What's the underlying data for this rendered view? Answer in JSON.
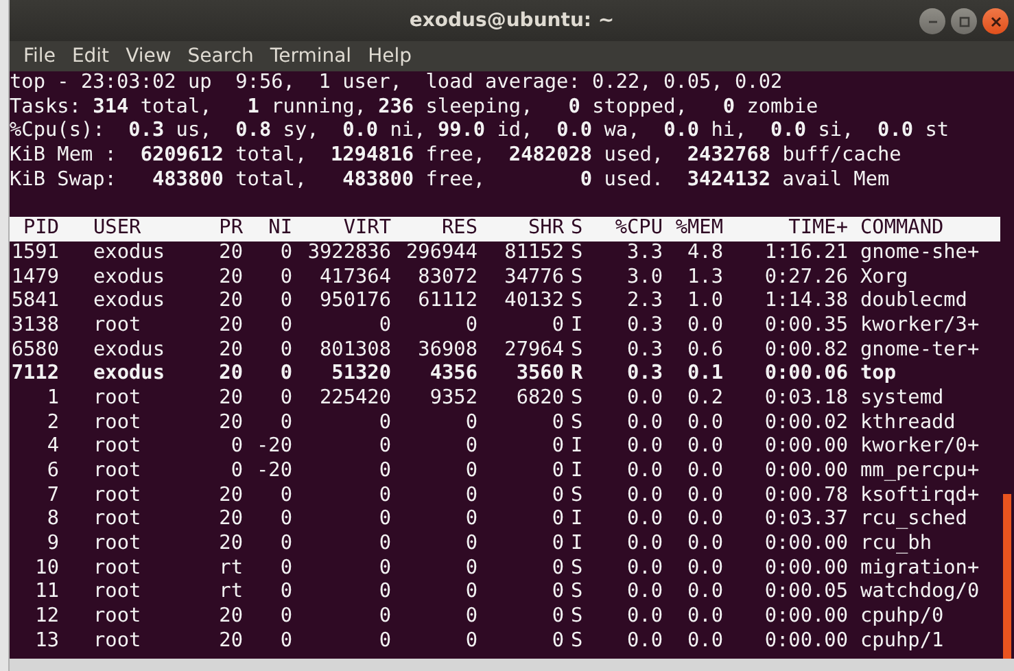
{
  "window": {
    "title": "exodus@ubuntu: ~"
  },
  "menu": [
    "File",
    "Edit",
    "View",
    "Search",
    "Terminal",
    "Help"
  ],
  "summary": [
    "top - 23:03:02 up  9:56,  1 user,  load average: 0.22, 0.05, 0.02",
    "Tasks: **314** total,   **1** running, **236** sleeping,   **0** stopped,   **0** zombie",
    "%Cpu(s):  **0.3** us,  **0.8** sy,  **0.0** ni, **99.0** id,  **0.0** wa,  **0.0** hi,  **0.0** si,  **0.0** st",
    "KiB Mem :  **6209612** total,  **1294816** free,  **2482028** used,  **2432768** buff/cache",
    "KiB Swap:   **483800** total,   **483800** free,        **0** used.  **3424132** avail Mem"
  ],
  "table": {
    "columns": [
      "PID",
      "USER",
      "PR",
      "NI",
      "VIRT",
      "RES",
      "SHR",
      "S",
      "%CPU",
      "%MEM",
      "TIME+",
      "COMMAND"
    ],
    "rows": [
      {
        "bold": false,
        "cells": [
          "1591",
          "exodus",
          "20",
          "0",
          "3922836",
          "296944",
          "81152",
          "S",
          "3.3",
          "4.8",
          "1:16.21",
          "gnome-she+"
        ]
      },
      {
        "bold": false,
        "cells": [
          "1479",
          "exodus",
          "20",
          "0",
          "417364",
          "83072",
          "34776",
          "S",
          "3.0",
          "1.3",
          "0:27.26",
          "Xorg"
        ]
      },
      {
        "bold": false,
        "cells": [
          "5841",
          "exodus",
          "20",
          "0",
          "950176",
          "61112",
          "40132",
          "S",
          "2.3",
          "1.0",
          "1:14.38",
          "doublecmd"
        ]
      },
      {
        "bold": false,
        "cells": [
          "3138",
          "root",
          "20",
          "0",
          "0",
          "0",
          "0",
          "I",
          "0.3",
          "0.0",
          "0:00.35",
          "kworker/3+"
        ]
      },
      {
        "bold": false,
        "cells": [
          "6580",
          "exodus",
          "20",
          "0",
          "801308",
          "36908",
          "27964",
          "S",
          "0.3",
          "0.6",
          "0:00.82",
          "gnome-ter+"
        ]
      },
      {
        "bold": true,
        "cells": [
          "7112",
          "exodus",
          "20",
          "0",
          "51320",
          "4356",
          "3560",
          "R",
          "0.3",
          "0.1",
          "0:00.06",
          "top"
        ]
      },
      {
        "bold": false,
        "cells": [
          "1",
          "root",
          "20",
          "0",
          "225420",
          "9352",
          "6820",
          "S",
          "0.0",
          "0.2",
          "0:03.18",
          "systemd"
        ]
      },
      {
        "bold": false,
        "cells": [
          "2",
          "root",
          "20",
          "0",
          "0",
          "0",
          "0",
          "S",
          "0.0",
          "0.0",
          "0:00.02",
          "kthreadd"
        ]
      },
      {
        "bold": false,
        "cells": [
          "4",
          "root",
          "0",
          "-20",
          "0",
          "0",
          "0",
          "I",
          "0.0",
          "0.0",
          "0:00.00",
          "kworker/0+"
        ]
      },
      {
        "bold": false,
        "cells": [
          "6",
          "root",
          "0",
          "-20",
          "0",
          "0",
          "0",
          "I",
          "0.0",
          "0.0",
          "0:00.00",
          "mm_percpu+"
        ]
      },
      {
        "bold": false,
        "cells": [
          "7",
          "root",
          "20",
          "0",
          "0",
          "0",
          "0",
          "S",
          "0.0",
          "0.0",
          "0:00.78",
          "ksoftirqd+"
        ]
      },
      {
        "bold": false,
        "cells": [
          "8",
          "root",
          "20",
          "0",
          "0",
          "0",
          "0",
          "I",
          "0.0",
          "0.0",
          "0:03.37",
          "rcu_sched"
        ]
      },
      {
        "bold": false,
        "cells": [
          "9",
          "root",
          "20",
          "0",
          "0",
          "0",
          "0",
          "I",
          "0.0",
          "0.0",
          "0:00.00",
          "rcu_bh"
        ]
      },
      {
        "bold": false,
        "cells": [
          "10",
          "root",
          "rt",
          "0",
          "0",
          "0",
          "0",
          "S",
          "0.0",
          "0.0",
          "0:00.00",
          "migration+"
        ]
      },
      {
        "bold": false,
        "cells": [
          "11",
          "root",
          "rt",
          "0",
          "0",
          "0",
          "0",
          "S",
          "0.0",
          "0.0",
          "0:00.05",
          "watchdog/0"
        ]
      },
      {
        "bold": false,
        "cells": [
          "12",
          "root",
          "20",
          "0",
          "0",
          "0",
          "0",
          "S",
          "0.0",
          "0.0",
          "0:00.00",
          "cpuhp/0"
        ]
      },
      {
        "bold": false,
        "cells": [
          "13",
          "root",
          "20",
          "0",
          "0",
          "0",
          "0",
          "S",
          "0.0",
          "0.0",
          "0:00.00",
          "cpuhp/1"
        ]
      }
    ]
  }
}
